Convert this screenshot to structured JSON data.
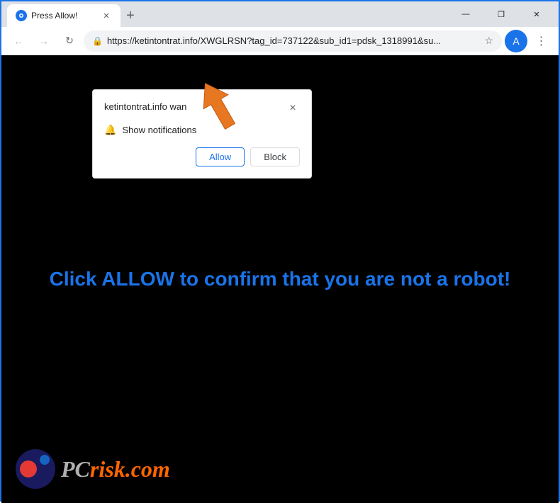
{
  "window": {
    "title": "Press Allow!",
    "close_label": "✕",
    "minimize_label": "—",
    "maximize_label": "❐"
  },
  "browser": {
    "url": "https://ketintontrat.info/XWGLRSN?tag_id=737122&sub_id1=pdsk_1318991&su...",
    "new_tab_label": "+",
    "back_label": "←",
    "forward_label": "→",
    "reload_label": "↻",
    "star_label": "☆",
    "profile_label": "A",
    "menu_label": "⋮"
  },
  "page": {
    "main_text_part1": "Click ",
    "main_text_highlight": "ALLOW",
    "main_text_part2": " to confirm that you are not a robot!"
  },
  "popup": {
    "title": "ketintontrat.info wan",
    "close_label": "×",
    "notification_label": "Show notifications",
    "allow_label": "Allow",
    "block_label": "Block"
  },
  "logo": {
    "pc_text": "PC",
    "risk_text": "risk",
    "dot_com_text": ".com"
  }
}
